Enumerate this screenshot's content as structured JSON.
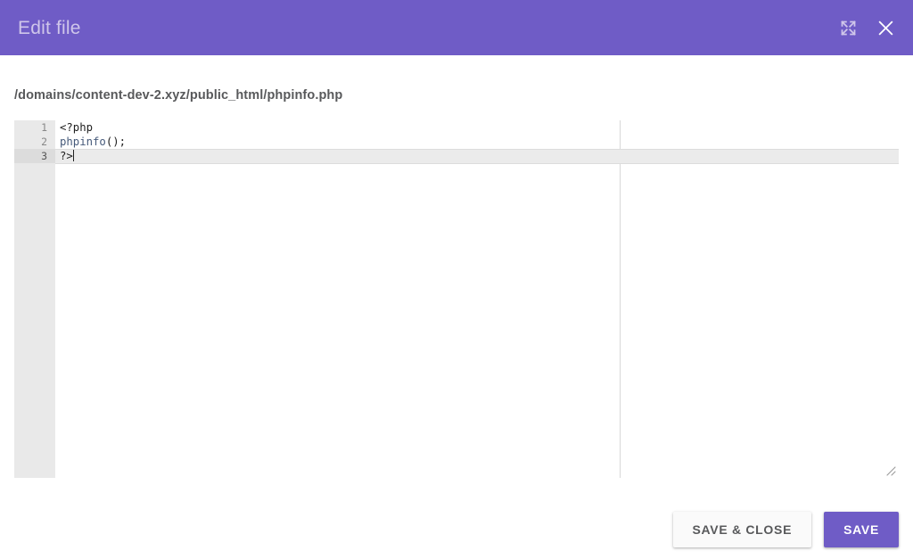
{
  "titlebar": {
    "title": "Edit file",
    "expand_icon": "expand-fullscreen-icon",
    "close_icon": "close-icon",
    "background_color": "#6f5cc6",
    "title_color": "#cfc6ea"
  },
  "file": {
    "path": "/domains/content-dev-2.xyz/public_html/phpinfo.php"
  },
  "editor": {
    "line_numbers": [
      "1",
      "2",
      "3"
    ],
    "active_line": "3",
    "lines": [
      {
        "number": "1",
        "text": "<?php"
      },
      {
        "number": "2",
        "text": "phpinfo();"
      },
      {
        "number": "3",
        "text": "?>"
      }
    ],
    "line2_tokens": {
      "func": "phpinfo",
      "punc": "();"
    },
    "gutter_color": "#e9e9e9",
    "active_line_color": "#ebebeb",
    "resize_handle": "resize-grip-icon"
  },
  "footer": {
    "save_close_label": "SAVE & CLOSE",
    "save_label": "SAVE",
    "primary_color": "#6f5cc6"
  }
}
